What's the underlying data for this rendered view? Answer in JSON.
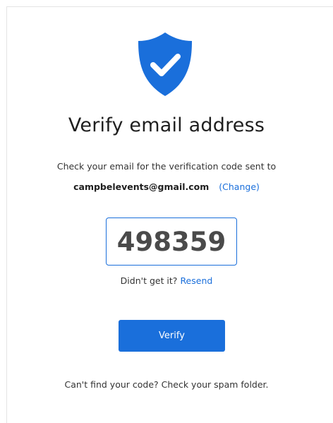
{
  "icon": {
    "name": "shield-check-icon",
    "color": "#1a6fdb"
  },
  "title": "Verify email address",
  "subtitle": "Check your email for the verification code sent to",
  "email": "campbelevents@gmail.com",
  "change_link": "(Change)",
  "code_value": "498359",
  "resend_prompt": "Didn't get it?",
  "resend_link": "Resend",
  "verify_button": "Verify",
  "footer_note": "Can't find your code? Check your spam folder.",
  "colors": {
    "accent": "#1a6fdb",
    "text": "#1f1f1f",
    "muted": "#333333"
  }
}
